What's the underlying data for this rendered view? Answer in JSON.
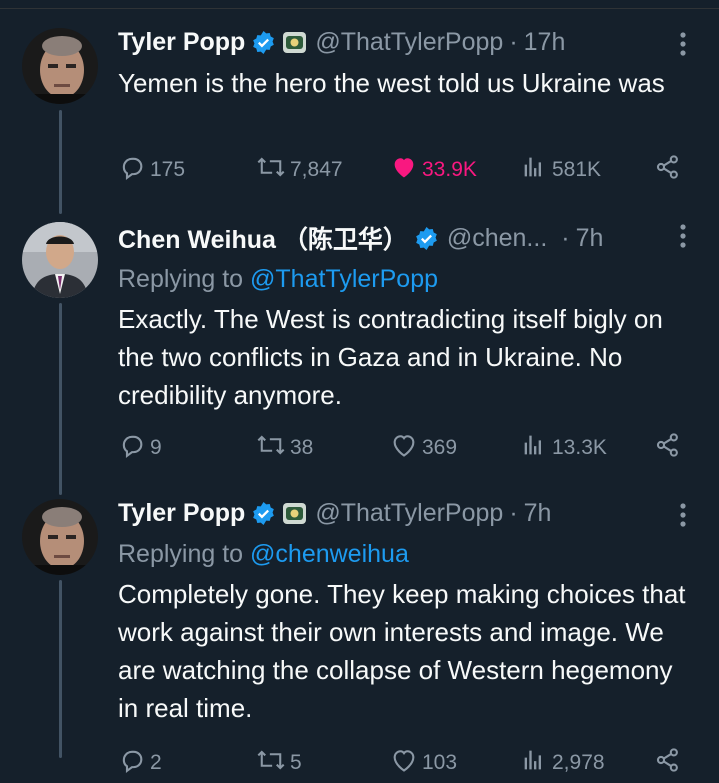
{
  "tweets": [
    {
      "name": "Tyler Popp",
      "handle": "@ThatTylerPopp",
      "dot": "·",
      "time": "17h",
      "replying_prefix": "",
      "replying_to": "",
      "text": "Yemen is the hero the west told us Ukraine was",
      "replies": "175",
      "retweets": "7,847",
      "likes": "33.9K",
      "views": "581K",
      "liked": true
    },
    {
      "name": "Chen Weihua （陈卫华）",
      "handle": "@chen...",
      "dot": "·",
      "time": "7h",
      "replying_prefix": "Replying to ",
      "replying_to": "@ThatTylerPopp",
      "text": "Exactly. The West is contradicting itself bigly on the two conflicts in Gaza and in Ukraine. No credibility anymore.",
      "replies": "9",
      "retweets": "38",
      "likes": "369",
      "views": "13.3K",
      "liked": false
    },
    {
      "name": "Tyler Popp",
      "handle": "@ThatTylerPopp",
      "dot": "·",
      "time": "7h",
      "replying_prefix": "Replying to ",
      "replying_to": "@chenweihua",
      "text": "Completely gone. They keep making choices that work against their own interests and image. We are watching the collapse of Western hegemony in real time.",
      "replies": "2",
      "retweets": "5",
      "likes": "103",
      "views": "2,978",
      "liked": false
    }
  ],
  "colors": {
    "background": "#15202b",
    "verified": "#1d9bf0",
    "like_active": "#f91880",
    "muted": "#8b98a5",
    "link": "#1d9bf0"
  },
  "icons": [
    "reply-icon",
    "retweet-icon",
    "like-icon",
    "views-icon",
    "share-icon",
    "verified-badge-icon",
    "affiliation-badge-icon",
    "more-options-icon"
  ]
}
